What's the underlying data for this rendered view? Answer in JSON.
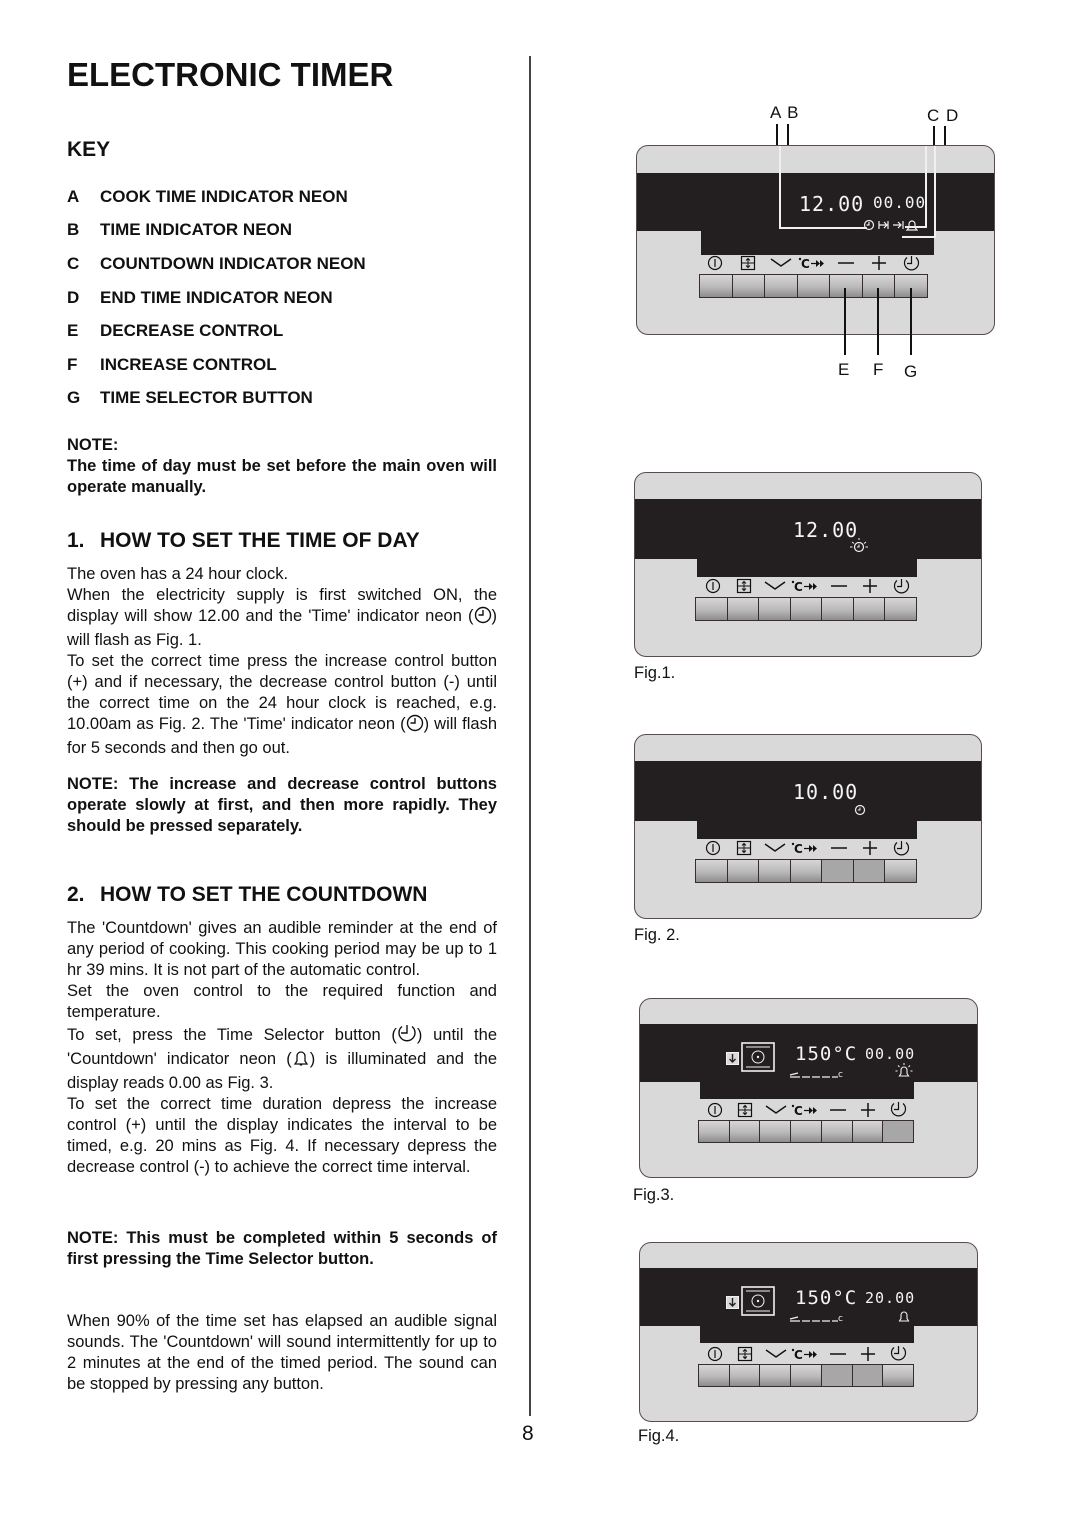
{
  "page": {
    "title": "ELECTRONIC TIMER",
    "page_number": "8"
  },
  "key": {
    "heading": "KEY",
    "items": [
      {
        "letter": "A",
        "label": "COOK TIME INDICATOR NEON"
      },
      {
        "letter": "B",
        "label": "TIME INDICATOR NEON"
      },
      {
        "letter": "C",
        "label": "COUNTDOWN INDICATOR NEON"
      },
      {
        "letter": "D",
        "label": "END TIME INDICATOR NEON"
      },
      {
        "letter": "E",
        "label": "DECREASE CONTROL"
      },
      {
        "letter": "F",
        "label": "INCREASE CONTROL"
      },
      {
        "letter": "G",
        "label": "TIME SELECTOR BUTTON"
      }
    ]
  },
  "note1": {
    "label": "NOTE:",
    "text": "The time of day must be set before the main oven will operate manually."
  },
  "section1": {
    "number": "1.",
    "heading": "HOW TO SET THE TIME OF DAY",
    "p1": "The oven has a 24 hour clock.",
    "p2a": "When the electricity supply is first switched ON, the display will show 12.00 and the 'Time' indicator neon (",
    "p2b": ") will flash as Fig. 1.",
    "p3a": "To set the correct time press the increase control button (+) and if necessary, the decrease control button (-) until the correct time on the 24 hour clock is reached, e.g. 10.00am as Fig. 2.  The 'Time' indicator neon (",
    "p3b": ") will flash for 5 seconds and then go out.",
    "note": "NOTE:   The increase and decrease control buttons operate slowly at first, and then more rapidly.  They should be pressed separately."
  },
  "section2": {
    "number": "2.",
    "heading": "HOW TO SET THE COUNTDOWN",
    "p1": "The 'Countdown' gives an audible reminder at the end of any period of cooking.  This cooking period may be  up to 1 hr 39 mins.  It is not part of the automatic control.",
    "p2": "Set the oven control to the required function and temperature.",
    "p3a": "To set, press the Time Selector button (",
    "p3b": ") until the 'Countdown' indicator neon (",
    "p3c": ") is illuminated and the display reads 0.00 as Fig. 3.",
    "p4": "To set the correct time duration depress the increase control (+) until the display indicates the interval to be timed, e.g. 20 mins as Fig. 4.  If necessary depress the decrease control (-) to achieve the correct time interval.",
    "note": "NOTE:  This must be completed within 5 seconds of first pressing the Time Selector button.",
    "p5": "When 90% of the time set has elapsed an audible signal sounds.  The 'Countdown' will sound intermittently for up to 2 minutes at the end of the timed period.  The sound can be stopped by pressing any button."
  },
  "figures": {
    "key_diagram": {
      "time_display": "12.00",
      "timer_display": "00.00",
      "top_labels": {
        "ab": "A B",
        "cd": "C D"
      },
      "bottom_labels": [
        "E",
        "F",
        "G"
      ],
      "pressed_buttons": []
    },
    "fig1": {
      "caption": "Fig.1.",
      "time_display": "12.00",
      "indicator": "time-flashing",
      "pressed_buttons": []
    },
    "fig2": {
      "caption": "Fig. 2.",
      "time_display": "10.00",
      "indicator": "time",
      "pressed_buttons": [
        4,
        5
      ]
    },
    "fig3": {
      "caption": "Fig.3.",
      "temp_display": "150°C",
      "timer_display": "00.00",
      "indicator": "countdown-flashing",
      "pressed_buttons": [
        6
      ]
    },
    "fig4": {
      "caption": "Fig.4.",
      "temp_display": "150°C",
      "timer_display": "20.00",
      "indicator": "countdown",
      "pressed_buttons": [
        4,
        5
      ]
    }
  },
  "panel_buttons": [
    {
      "icon": "power-icon"
    },
    {
      "icon": "oven-function-icon"
    },
    {
      "icon": "chevron-down-icon"
    },
    {
      "icon": "rapid-heat-icon"
    },
    {
      "icon": "minus-icon"
    },
    {
      "icon": "plus-icon"
    },
    {
      "icon": "clock-icon"
    }
  ]
}
